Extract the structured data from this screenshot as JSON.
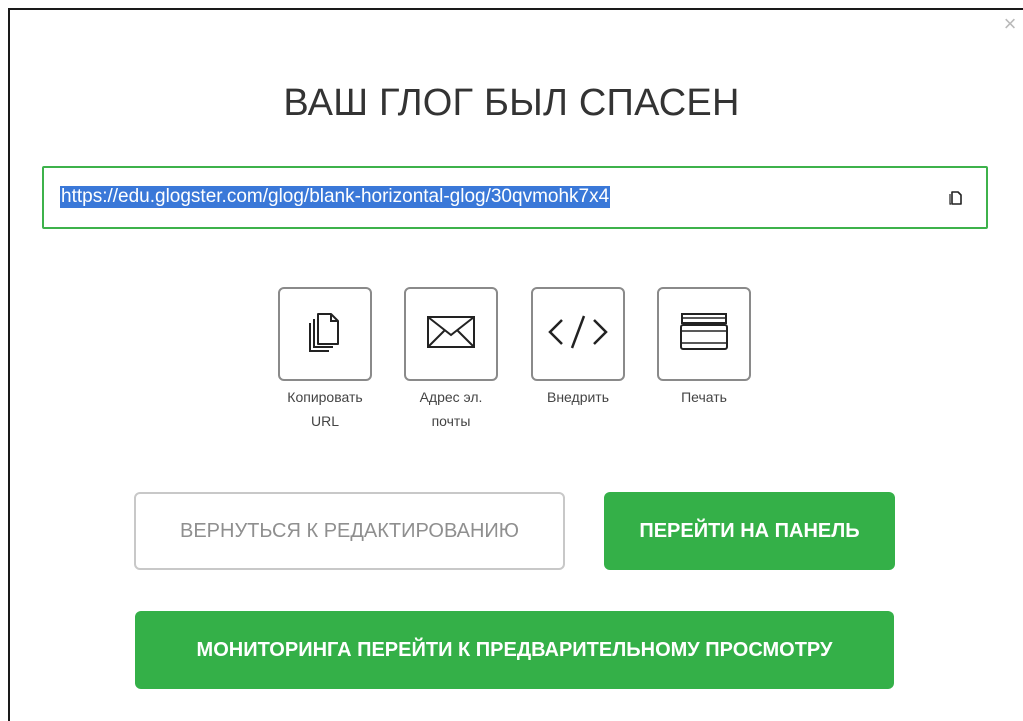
{
  "dialog": {
    "close_label": "×",
    "title": "ВАШ ГЛОГ БЫЛ СПАСЕН"
  },
  "url_field": {
    "value": "https://edu.glogster.com/glog/blank-horizontal-glog/30qvmohk7x4",
    "copy_icon": "copy-icon"
  },
  "share_options": [
    {
      "icon": "copy-icon",
      "label": "Копировать\nURL"
    },
    {
      "icon": "envelope-icon",
      "label": "Адрес эл.\nпочты"
    },
    {
      "icon": "code-icon",
      "label": "Внедрить"
    },
    {
      "icon": "printer-icon",
      "label": "Печать"
    }
  ],
  "actions": {
    "back_to_edit": "ВЕРНУТЬСЯ К РЕДАКТИРОВАНИЮ",
    "go_to_dashboard": "ПЕРЕЙТИ НА ПАНЕЛЬ",
    "go_to_preview": "МОНИТОРИНГА ПЕРЕЙТИ К ПРЕДВАРИТЕЛЬНОМУ ПРОСМОТРУ"
  },
  "colors": {
    "accent_green": "#34b048",
    "url_border": "#3db24b",
    "selection_blue": "#3a78d8"
  }
}
